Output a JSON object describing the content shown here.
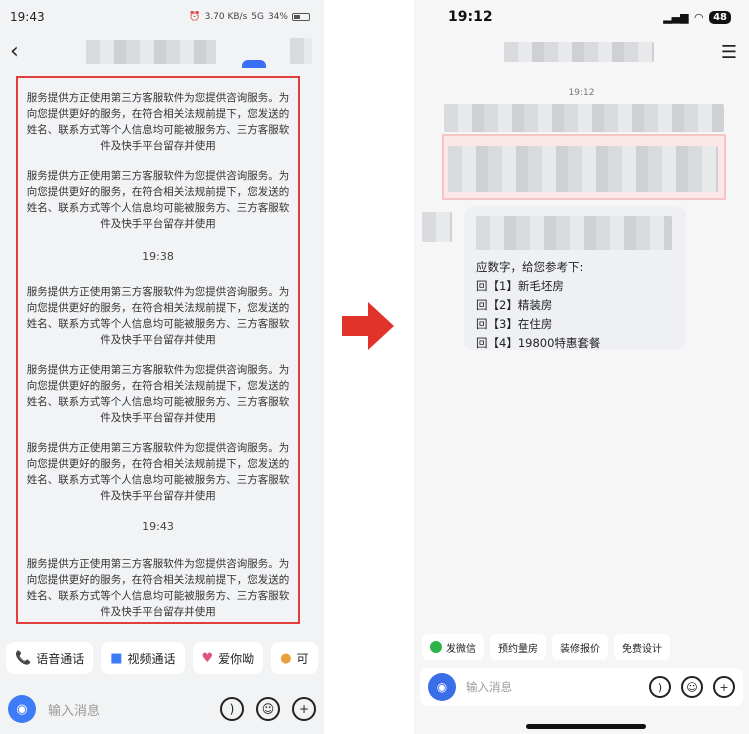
{
  "left": {
    "status": {
      "time": "19:43",
      "network": "3.70 KB/s",
      "signal": "5G",
      "battery": "34%"
    },
    "messages": [
      {
        "type": "text",
        "text": "服务提供方正使用第三方客服软件为您提供咨询服务。为向您提供更好的服务，在符合相关法规前提下，您发送的姓名、联系方式等个人信息均可能被服务方、三方客服软件及快手平台留存并使用"
      },
      {
        "type": "text",
        "text": "服务提供方正使用第三方客服软件为您提供咨询服务。为向您提供更好的服务，在符合相关法规前提下，您发送的姓名、联系方式等个人信息均可能被服务方、三方客服软件及快手平台留存并使用"
      },
      {
        "type": "time",
        "text": "19:38"
      },
      {
        "type": "text",
        "text": "服务提供方正使用第三方客服软件为您提供咨询服务。为向您提供更好的服务，在符合相关法规前提下，您发送的姓名、联系方式等个人信息均可能被服务方、三方客服软件及快手平台留存并使用"
      },
      {
        "type": "text",
        "text": "服务提供方正使用第三方客服软件为您提供咨询服务。为向您提供更好的服务，在符合相关法规前提下，您发送的姓名、联系方式等个人信息均可能被服务方、三方客服软件及快手平台留存并使用"
      },
      {
        "type": "text",
        "text": "服务提供方正使用第三方客服软件为您提供咨询服务。为向您提供更好的服务，在符合相关法规前提下，您发送的姓名、联系方式等个人信息均可能被服务方、三方客服软件及快手平台留存并使用"
      },
      {
        "type": "time",
        "text": "19:43"
      },
      {
        "type": "text",
        "text": "服务提供方正使用第三方客服软件为您提供咨询服务。为向您提供更好的服务，在符合相关法规前提下，您发送的姓名、联系方式等个人信息均可能被服务方、三方客服软件及快手平台留存并使用"
      }
    ],
    "quick_actions": [
      {
        "icon": "phone-icon",
        "label": "语音通话"
      },
      {
        "icon": "video-icon",
        "label": "视频通话"
      },
      {
        "icon": "heart-emoji-icon",
        "label": "爱你呦"
      },
      {
        "icon": "cat-emoji-icon",
        "label": "可"
      }
    ],
    "input_placeholder": "输入消息"
  },
  "right": {
    "status": {
      "time": "19:12",
      "battery": "48"
    },
    "timestamp": "19:12",
    "reply_lines": [
      "应数字，给您参考下:",
      "回【1】新毛坯房",
      "回【2】精装房",
      "回【3】在住房",
      "回【4】19800特惠套餐"
    ],
    "chips": [
      {
        "icon": "wechat-icon",
        "label": "发微信"
      },
      {
        "icon": "",
        "label": "预约量房"
      },
      {
        "icon": "",
        "label": "装修报价"
      },
      {
        "icon": "",
        "label": "免费设计"
      }
    ],
    "input_placeholder": "输入消息"
  },
  "colors": {
    "highlight_border": "#e23d3d",
    "arrow": "#e2332b",
    "accent_blue": "#3d7cf6"
  }
}
